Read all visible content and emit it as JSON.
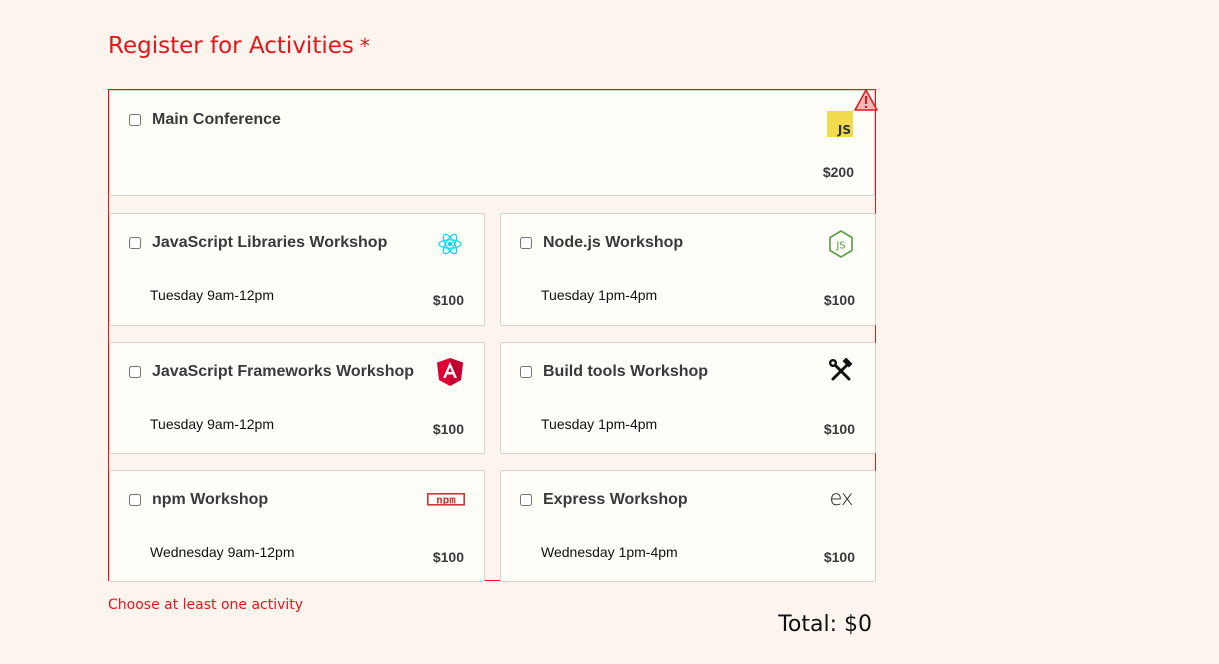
{
  "legend": {
    "title": "Register for Activities",
    "required_mark": "*"
  },
  "colors": {
    "error": "#e8141b",
    "background": "#fcf5ee",
    "card": "#fffdf8"
  },
  "activities": [
    {
      "name": "Main Conference",
      "time": "",
      "cost": "$200",
      "icon": "javascript-icon",
      "logo_text": "JS"
    },
    {
      "name": "JavaScript Libraries Workshop",
      "time": "Tuesday 9am-12pm",
      "cost": "$100",
      "icon": "react-icon"
    },
    {
      "name": "Node.js Workshop",
      "time": "Tuesday 1pm-4pm",
      "cost": "$100",
      "icon": "nodejs-icon"
    },
    {
      "name": "JavaScript Frameworks Workshop",
      "time": "Tuesday 9am-12pm",
      "cost": "$100",
      "icon": "angular-icon"
    },
    {
      "name": "Build tools Workshop",
      "time": "Tuesday 1pm-4pm",
      "cost": "$100",
      "icon": "hammer-wrench-icon"
    },
    {
      "name": "npm Workshop",
      "time": "Wednesday 9am-12pm",
      "cost": "$100",
      "icon": "npm-icon",
      "logo_text": "npm"
    },
    {
      "name": "Express Workshop",
      "time": "Wednesday 1pm-4pm",
      "cost": "$100",
      "icon": "express-icon",
      "logo_text": "ex"
    }
  ],
  "error_message": "Choose at least one activity",
  "total": "Total: $0"
}
